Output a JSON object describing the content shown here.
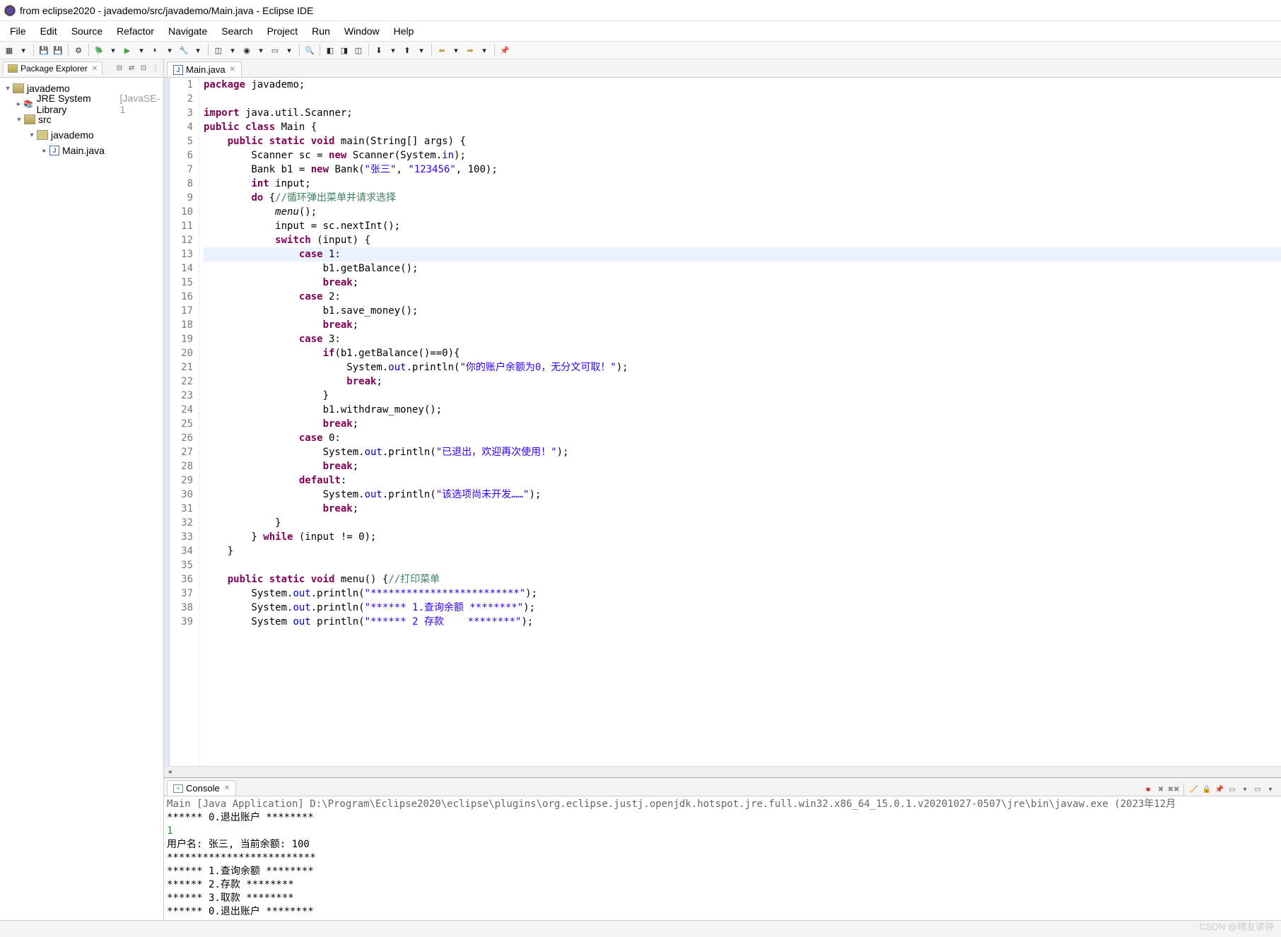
{
  "window": {
    "title": "from eclipse2020 - javademo/src/javademo/Main.java - Eclipse IDE"
  },
  "menubar": [
    "File",
    "Edit",
    "Source",
    "Refactor",
    "Navigate",
    "Search",
    "Project",
    "Run",
    "Window",
    "Help"
  ],
  "package_explorer": {
    "title": "Package Explorer",
    "tree": {
      "project": "javademo",
      "lib": "JRE System Library",
      "lib_annot": "[JavaSE-1",
      "src": "src",
      "pkg": "javademo",
      "file": "Main.java"
    }
  },
  "editor": {
    "tab": "Main.java",
    "highlight_line": 13,
    "lines": [
      {
        "n": 1,
        "html": "<span class='kw'>package</span> javademo;"
      },
      {
        "n": 2,
        "html": ""
      },
      {
        "n": 3,
        "html": "<span class='kw'>import</span> java.util.Scanner;"
      },
      {
        "n": 4,
        "html": "<span class='kw'>public</span> <span class='kw'>class</span> Main {"
      },
      {
        "n": 5,
        "html": "    <span class='kw'>public</span> <span class='kw'>static</span> <span class='kw'>void</span> main(String[] args) {"
      },
      {
        "n": 6,
        "html": "        Scanner sc = <span class='kw'>new</span> Scanner(System.<span class='fld'>in</span>);"
      },
      {
        "n": 7,
        "html": "        Bank b1 = <span class='kw'>new</span> Bank(<span class='str'>\"张三\"</span>, <span class='str'>\"123456\"</span>, 100);"
      },
      {
        "n": 8,
        "html": "        <span class='kw'>int</span> input;"
      },
      {
        "n": 9,
        "html": "        <span class='kw'>do</span> {<span class='cmt'>//循环弹出菜单并请求选择</span>"
      },
      {
        "n": 10,
        "html": "            <span class='mtd'>menu</span>();"
      },
      {
        "n": 11,
        "html": "            input = sc.nextInt();"
      },
      {
        "n": 12,
        "html": "            <span class='kw'>switch</span> (input) {"
      },
      {
        "n": 13,
        "html": "                <span class='kw'>case</span> 1:"
      },
      {
        "n": 14,
        "html": "                    b1.getBalance();"
      },
      {
        "n": 15,
        "html": "                    <span class='kw'>break</span>;"
      },
      {
        "n": 16,
        "html": "                <span class='kw'>case</span> 2:"
      },
      {
        "n": 17,
        "html": "                    b1.save_money();"
      },
      {
        "n": 18,
        "html": "                    <span class='kw'>break</span>;"
      },
      {
        "n": 19,
        "html": "                <span class='kw'>case</span> 3:"
      },
      {
        "n": 20,
        "html": "                    <span class='kw'>if</span>(b1.getBalance()==0){"
      },
      {
        "n": 21,
        "html": "                        System.<span class='fld'>out</span>.println(<span class='str'>\"你的账户余额为0，无分文可取！\"</span>);"
      },
      {
        "n": 22,
        "html": "                        <span class='kw'>break</span>;"
      },
      {
        "n": 23,
        "html": "                    }"
      },
      {
        "n": 24,
        "html": "                    b1.withdraw_money();"
      },
      {
        "n": 25,
        "html": "                    <span class='kw'>break</span>;"
      },
      {
        "n": 26,
        "html": "                <span class='kw'>case</span> 0:"
      },
      {
        "n": 27,
        "html": "                    System.<span class='fld'>out</span>.println(<span class='str'>\"已退出，欢迎再次使用！\"</span>);"
      },
      {
        "n": 28,
        "html": "                    <span class='kw'>break</span>;"
      },
      {
        "n": 29,
        "html": "                <span class='kw'>default</span>:"
      },
      {
        "n": 30,
        "html": "                    System.<span class='fld'>out</span>.println(<span class='str'>\"该选项尚未开发……\"</span>);"
      },
      {
        "n": 31,
        "html": "                    <span class='kw'>break</span>;"
      },
      {
        "n": 32,
        "html": "            }"
      },
      {
        "n": 33,
        "html": "        } <span class='kw'>while</span> (input != 0);"
      },
      {
        "n": 34,
        "html": "    }"
      },
      {
        "n": 35,
        "html": ""
      },
      {
        "n": 36,
        "html": "    <span class='kw'>public</span> <span class='kw'>static</span> <span class='kw'>void</span> menu() {<span class='cmt'>//打印菜单</span>"
      },
      {
        "n": 37,
        "html": "        System.<span class='fld'>out</span>.println(<span class='str'>\"*************************\"</span>);"
      },
      {
        "n": 38,
        "html": "        System.<span class='fld'>out</span>.println(<span class='str'>\"****** 1.查询余额 ********\"</span>);"
      },
      {
        "n": 39,
        "html": "        System <span class='fld'>out</span> println(<span class='str'>\"****** 2 存款    ********\"</span>);"
      }
    ]
  },
  "console": {
    "title": "Console",
    "description": "Main [Java Application] D:\\Program\\Eclipse2020\\eclipse\\plugins\\org.eclipse.justj.openjdk.hotspot.jre.full.win32.x86_64_15.0.1.v20201027-0507\\jre\\bin\\javaw.exe  (2023年12月",
    "lines": [
      {
        "cls": "",
        "text": "****** 0.退出账户 ********"
      },
      {
        "cls": "console-green",
        "text": "1"
      },
      {
        "cls": "",
        "text": "用户名: 张三, 当前余额: 100"
      },
      {
        "cls": "",
        "text": "*************************"
      },
      {
        "cls": "",
        "text": "****** 1.查询余额 ********"
      },
      {
        "cls": "",
        "text": "****** 2.存款    ********"
      },
      {
        "cls": "",
        "text": "****** 3.取款    ********"
      },
      {
        "cls": "",
        "text": "****** 0.退出账户 ********"
      }
    ]
  },
  "watermark": "CSDN @晴友读钟"
}
